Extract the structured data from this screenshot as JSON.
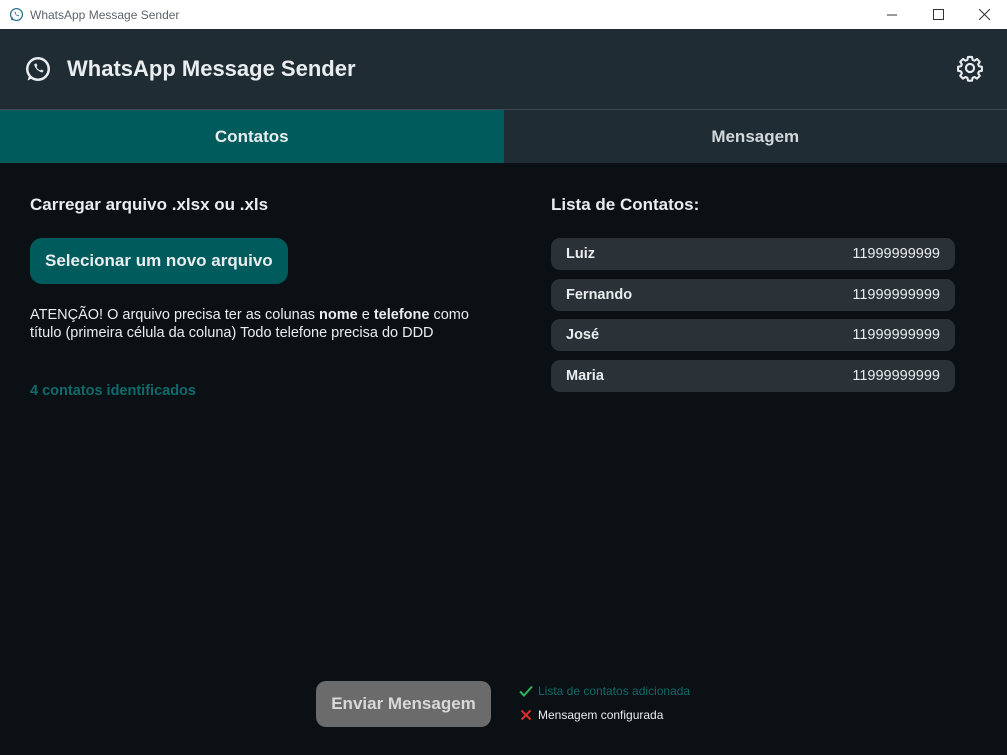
{
  "window": {
    "title": "WhatsApp Message Sender",
    "controls": [
      "minimize",
      "maximize",
      "close"
    ]
  },
  "header": {
    "app_title": "WhatsApp Message Sender",
    "logo_icon": "whatsapp-icon",
    "settings_icon": "gear-icon"
  },
  "tabs": [
    {
      "label": "Contatos",
      "active": true
    },
    {
      "label": "Mensagem",
      "active": false
    }
  ],
  "upload": {
    "title": "Carregar arquivo .xlsx ou .xls",
    "button_label": "Selecionar um novo arquivo",
    "warning_prefix": "ATENÇÃO! O arquivo precisa ter as colunas ",
    "warning_col1": "nome",
    "warning_and": " e ",
    "warning_col2": "telefone",
    "warning_suffix": " como título (primeira célula da coluna) Todo telefone precisa do DDD",
    "count_text": "4 contatos identificados"
  },
  "contacts": {
    "title": "Lista de Contatos:",
    "items": [
      {
        "name": "Luiz",
        "phone": "11999999999"
      },
      {
        "name": "Fernando",
        "phone": "11999999999"
      },
      {
        "name": "José",
        "phone": "11999999999"
      },
      {
        "name": "Maria",
        "phone": "11999999999"
      }
    ]
  },
  "footer": {
    "send_label": "Enviar Mensagem",
    "status": [
      {
        "text": "Lista de contatos adicionada",
        "ok": true,
        "icon": "check-icon"
      },
      {
        "text": "Mensagem configurada",
        "ok": false,
        "icon": "cross-icon"
      }
    ]
  },
  "colors": {
    "accent": "#005c5c",
    "accent_text": "#0f6b6b",
    "background": "#0b1014",
    "header": "#202c33",
    "check": "#2fb35b",
    "cross": "#e02b2b"
  }
}
